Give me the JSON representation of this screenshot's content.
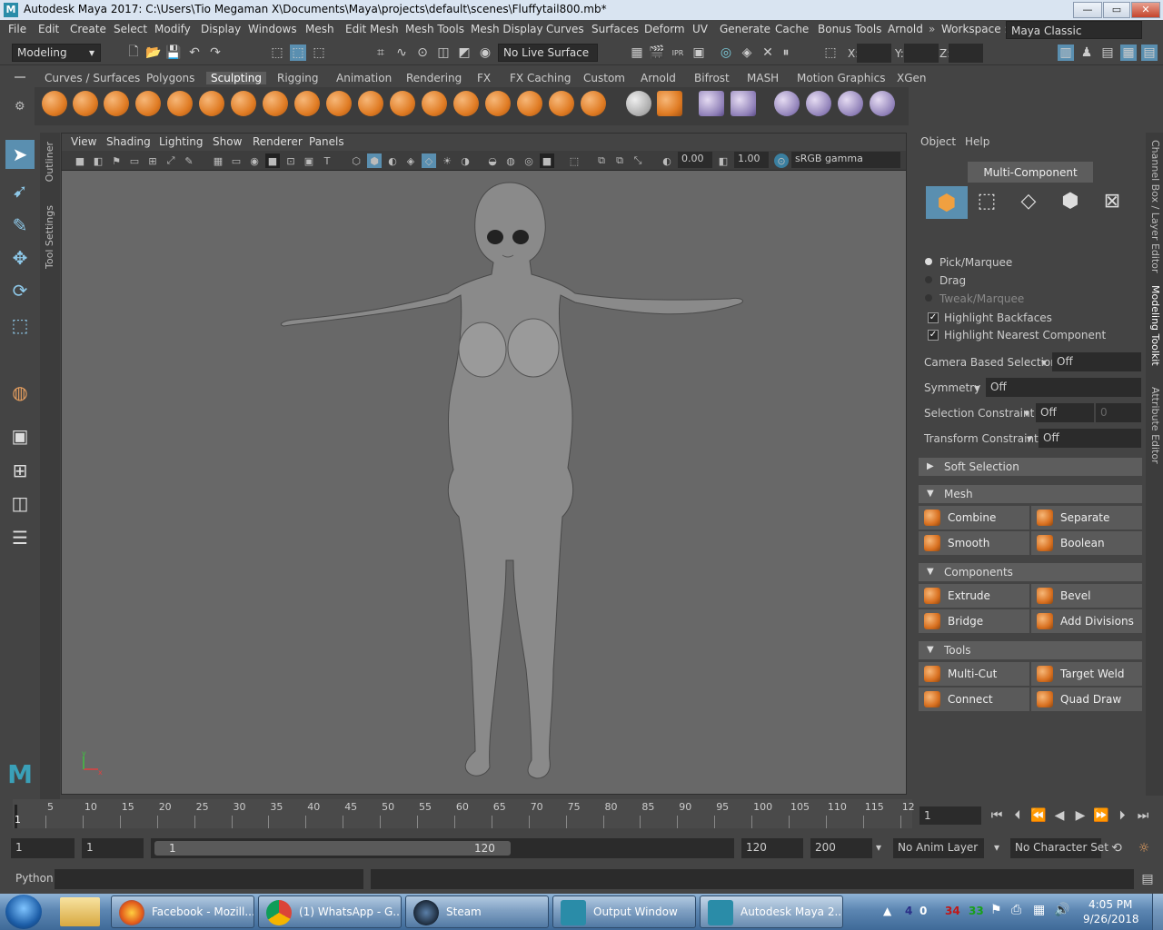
{
  "window": {
    "title": "Autodesk Maya 2017: C:\\Users\\Tio Megaman X\\Documents\\Maya\\projects\\default\\scenes\\Fluffytail800.mb*",
    "minimize": "—",
    "maximize": "▭",
    "close": "✕"
  },
  "menubar": {
    "items": [
      "File",
      "Edit",
      "Create",
      "Select",
      "Modify",
      "Display",
      "Windows",
      "Mesh",
      "Edit Mesh",
      "Mesh Tools",
      "Mesh Display",
      "Curves",
      "Surfaces",
      "Deform",
      "UV",
      "Generate",
      "Cache",
      "Bonus Tools",
      "Arnold"
    ],
    "workspace_label": "Workspace :",
    "workspace_value": "Maya Classic"
  },
  "statusline": {
    "mode": "Modeling",
    "live_surface": "No Live Surface",
    "x_label": "X:",
    "y_label": "Y:",
    "z_label": "Z:"
  },
  "shelf_tabs": {
    "items": [
      "Curves / Surfaces",
      "Polygons",
      "Sculpting",
      "Rigging",
      "Animation",
      "Rendering",
      "FX",
      "FX Caching",
      "Custom",
      "Arnold",
      "Bifrost",
      "MASH",
      "Motion Graphics",
      "XGen"
    ],
    "selected": "Sculpting"
  },
  "side_tabs": {
    "outliner": "Outliner",
    "tool_settings": "Tool Settings"
  },
  "viewport": {
    "menu": [
      "View",
      "Shading",
      "Lighting",
      "Show",
      "Renderer",
      "Panels"
    ],
    "exposure": "0.00",
    "gamma": "1.00",
    "color_space": "sRGB gamma",
    "axis_x": "x",
    "axis_y": "y"
  },
  "toolkit": {
    "menu": [
      "Object",
      "Help"
    ],
    "mode_label": "Multi-Component",
    "pick_marquee": "Pick/Marquee",
    "drag": "Drag",
    "tweak_marquee": "Tweak/Marquee",
    "highlight_backfaces": "Highlight Backfaces",
    "highlight_nearest": "Highlight Nearest Component",
    "check_mark": "✓",
    "camera_based_label": "Camera Based Selection",
    "camera_based_value": "Off",
    "symmetry_label": "Symmetry",
    "symmetry_value": "Off",
    "selection_constraint_label": "Selection Constraint",
    "selection_constraint_value": "Off",
    "selection_constraint_num": "0",
    "transform_constraint_label": "Transform Constraint",
    "transform_constraint_value": "Off",
    "soft_selection": "Soft Selection",
    "mesh_header": "Mesh",
    "mesh_buttons": [
      "Combine",
      "Separate",
      "Smooth",
      "Boolean"
    ],
    "components_header": "Components",
    "components_buttons": [
      "Extrude",
      "Bevel",
      "Bridge",
      "Add Divisions"
    ],
    "tools_header": "Tools",
    "tools_buttons": [
      "Multi-Cut",
      "Target Weld",
      "Connect",
      "Quad Draw"
    ]
  },
  "right_tabs": {
    "channel_box": "Channel Box / Layer Editor",
    "modeling_toolkit": "Modeling Toolkit",
    "attribute_editor": "Attribute Editor"
  },
  "timeline": {
    "ticks": [
      "5",
      "10",
      "15",
      "20",
      "25",
      "30",
      "35",
      "40",
      "45",
      "50",
      "55",
      "60",
      "65",
      "70",
      "75",
      "80",
      "85",
      "90",
      "95",
      "100",
      "105",
      "110",
      "115",
      "12"
    ],
    "current_frame_marker": "1",
    "current_frame": "1"
  },
  "range": {
    "start": "1",
    "playback_start": "1",
    "slider_start": "1",
    "slider_end": "120",
    "playback_end": "120",
    "end": "200",
    "anim_layer": "No Anim Layer",
    "character_set": "No Character Set"
  },
  "cmdline": {
    "language": "Python"
  },
  "taskbar": {
    "apps": [
      "Facebook - Mozill...",
      "(1) WhatsApp - G...",
      "Steam",
      "Output Window",
      "Autodesk Maya 2..."
    ],
    "tray_numbers": [
      "4",
      "0",
      "34",
      "33"
    ],
    "time": "4:05 PM",
    "date": "9/26/2018"
  }
}
